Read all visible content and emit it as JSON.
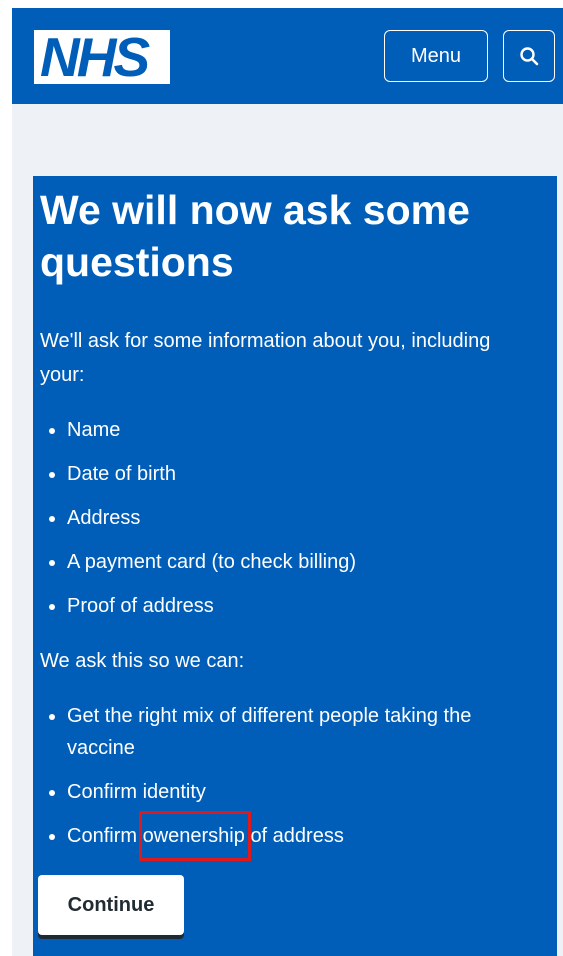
{
  "header": {
    "logo_text": "NHS",
    "menu_label": "Menu",
    "search_icon": "search-icon"
  },
  "main": {
    "title": "We will now ask some questions",
    "intro": "We'll ask for some information about you, including your:",
    "info_items": [
      "Name",
      "Date of birth",
      "Address",
      "A payment card (to check billing)",
      "Proof of address"
    ],
    "reason_intro": "We ask this so we can:",
    "reasons": {
      "r1": "Get the right mix of different people taking the vaccine",
      "r2": "Confirm identity",
      "r3_prefix": "Confirm",
      "r3_highlight": "owenership",
      "r3_suffix": "of address"
    },
    "continue_label": "Continue"
  },
  "colors": {
    "brand_blue": "#005eb8",
    "page_grey": "#eef2f6",
    "highlight_red": "#e0191d"
  }
}
